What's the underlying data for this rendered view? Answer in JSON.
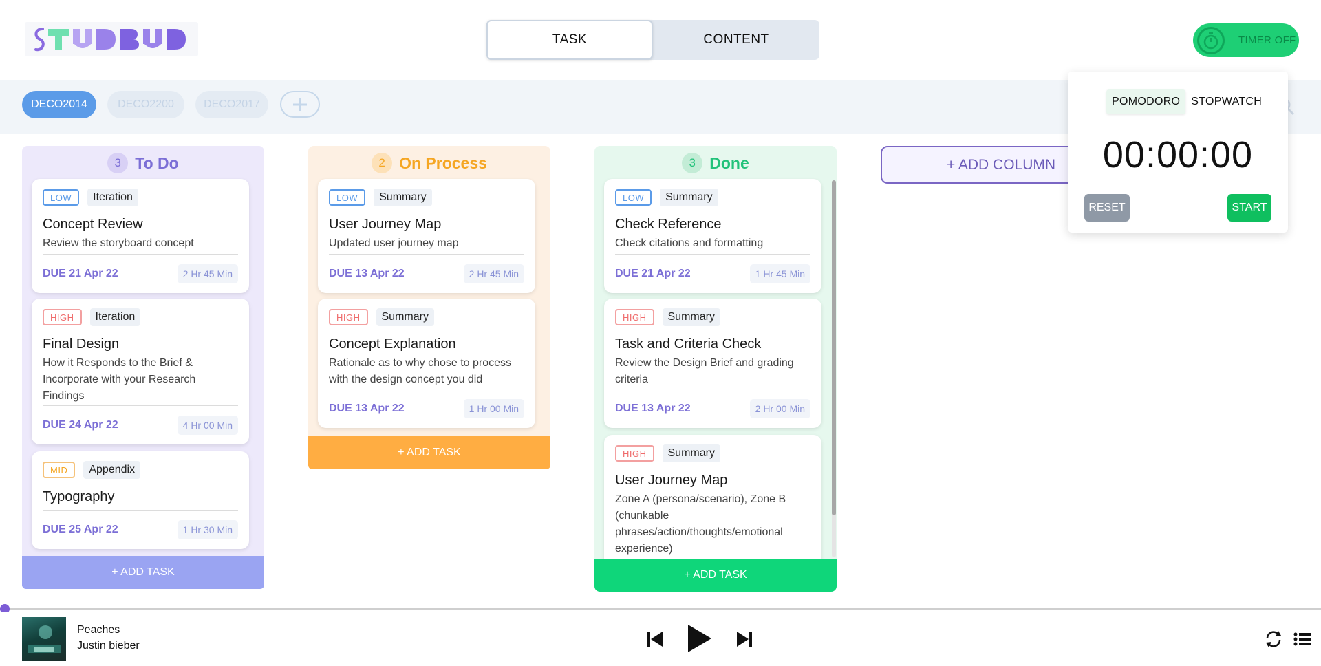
{
  "header": {
    "logo_text": "STUDBUD",
    "mode_tabs": [
      {
        "label": "TASK",
        "active": true
      },
      {
        "label": "CONTENT",
        "active": false
      }
    ],
    "timer_toggle_label": "TIMER OFF"
  },
  "courses": {
    "items": [
      {
        "label": "DECO2014",
        "active": true
      },
      {
        "label": "DECO2200",
        "active": false
      },
      {
        "label": "DECO2017",
        "active": false
      }
    ],
    "add_icon": "plus-icon",
    "search_icon": "search-icon"
  },
  "columns": [
    {
      "title": "To Do",
      "count": "3",
      "color": "#7c6fd6",
      "bg": "#ede9fb",
      "add_task_label": "+ ADD TASK",
      "add_task_color": "#9aa4f2",
      "cards": [
        {
          "priority": "LOW",
          "category": "Iteration",
          "title": "Concept Review",
          "desc": "Review the storyboard concept",
          "due": "DUE 21 Apr 22",
          "duration": "2 Hr 45 Min"
        },
        {
          "priority": "HIGH",
          "category": "Iteration",
          "title": "Final Design",
          "desc": "How it Responds to the Brief & Incorporate with your Research Findings",
          "due": "DUE 24 Apr 22",
          "duration": "4 Hr 00 Min"
        },
        {
          "priority": "MID",
          "category": "Appendix",
          "title": "Typography",
          "desc": "",
          "due": "DUE 25 Apr 22",
          "duration": "1 Hr 30 Min"
        }
      ]
    },
    {
      "title": "On Process",
      "count": "2",
      "color": "#f5a623",
      "bg": "#fdf0e3",
      "add_task_label": "+ ADD TASK",
      "add_task_color": "#ffad42",
      "cards": [
        {
          "priority": "LOW",
          "category": "Summary",
          "title": "User Journey Map",
          "desc": "Updated user journey map",
          "due": "DUE 13 Apr 22",
          "duration": "2 Hr 45 Min"
        },
        {
          "priority": "HIGH",
          "category": "Summary",
          "title": "Concept Explanation",
          "desc": "Rationale as to why chose to process with the design concept you did",
          "due": "DUE 13 Apr 22",
          "duration": "1 Hr 00 Min"
        }
      ]
    },
    {
      "title": "Done",
      "count": "3",
      "color": "#22c27a",
      "bg": "#e6f8ee",
      "add_task_label": "+ ADD TASK",
      "add_task_color": "#0fd67a",
      "cards": [
        {
          "priority": "LOW",
          "category": "Summary",
          "title": "Check Reference",
          "desc": "Check citations and formatting",
          "due": "DUE 21 Apr 22",
          "duration": "1 Hr 45 Min"
        },
        {
          "priority": "HIGH",
          "category": "Summary",
          "title": "Task and Criteria Check",
          "desc": "Review the Design Brief and grading criteria",
          "due": "DUE 13 Apr 22",
          "duration": "2 Hr 00 Min"
        },
        {
          "priority": "HIGH",
          "category": "Summary",
          "title": "User Journey Map",
          "desc": "Zone A (persona/scenario), Zone B (chunkable phrases/action/thoughts/emotional experience)",
          "due": "",
          "duration": ""
        }
      ]
    }
  ],
  "add_column_label": "+ ADD COLUMN",
  "timer_popup": {
    "tabs": [
      {
        "label": "POMODORO",
        "active": true
      },
      {
        "label": "STOPWATCH",
        "active": false
      }
    ],
    "display": "00:00:00",
    "reset_label": "RESET",
    "start_label": "START"
  },
  "player": {
    "song_title": "Peaches",
    "artist": "Justin bieber",
    "progress": 0,
    "controls": [
      "skip-back-icon",
      "play-icon",
      "skip-forward-icon",
      "repeat-icon",
      "playlist-icon"
    ]
  }
}
